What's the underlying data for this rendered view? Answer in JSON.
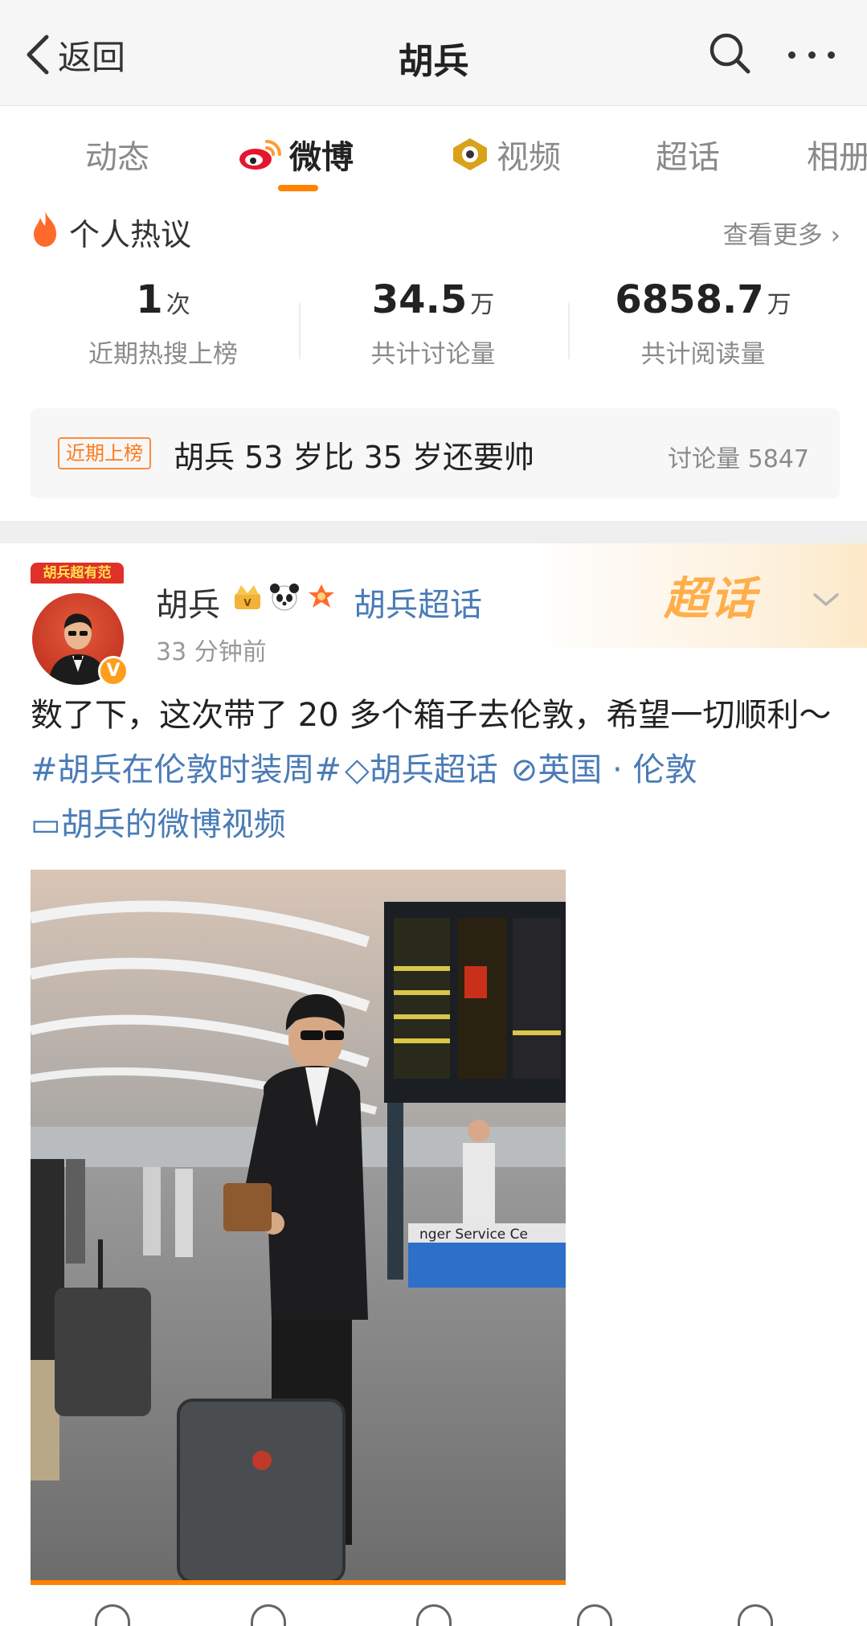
{
  "header": {
    "back_label": "返回",
    "title": "胡兵"
  },
  "tabs": [
    {
      "label": "动态"
    },
    {
      "label": "微博"
    },
    {
      "label": "视频"
    },
    {
      "label": "超话"
    },
    {
      "label": "相册"
    }
  ],
  "active_tab": "微博",
  "hot": {
    "title": "个人热议",
    "more_label": "查看更多 ›",
    "stats": [
      {
        "value": "1",
        "unit": "次",
        "label": "近期热搜上榜"
      },
      {
        "value": "34.5",
        "unit": "万",
        "label": "共计讨论量"
      },
      {
        "value": "6858.7",
        "unit": "万",
        "label": "共计阅读量"
      }
    ],
    "trend": {
      "badge": "近期上榜",
      "text": "胡兵 53 岁比 35 岁还要帅",
      "count_label": "讨论量 5847"
    }
  },
  "post": {
    "supertalk_logo": "超话",
    "avatar_banner": "胡兵超有范",
    "author": "胡兵",
    "super_link": "胡兵超话",
    "time": "33 分钟前",
    "text_plain": "数了下，这次带了 20 多个箱子去伦敦，希望一切顺利～",
    "hashtag": "#胡兵在伦敦时装周#",
    "super_topic": "◇胡兵超话",
    "location": "⊘英国 · 伦敦",
    "video_link": "▭胡兵的微博视频",
    "photo_sign": "nger Service Ce"
  },
  "colors": {
    "accent": "#ff8200",
    "link": "#4a7bb7",
    "muted": "#8a8a8a"
  }
}
